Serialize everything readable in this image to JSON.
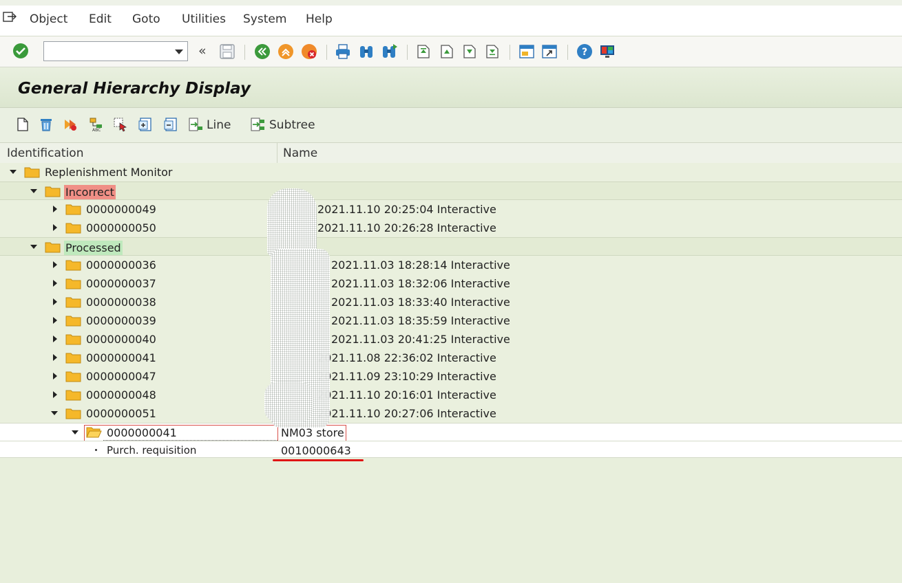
{
  "menu": {
    "items": [
      {
        "label": "Object"
      },
      {
        "label": "Edit"
      },
      {
        "label": "Goto"
      },
      {
        "label": "Utilities"
      },
      {
        "label": "System"
      },
      {
        "label": "Help"
      }
    ]
  },
  "toolbar": {
    "command_value": "",
    "back_glyph": "«"
  },
  "title": "General Hierarchy Display",
  "app_toolbar": {
    "line_label": "Line",
    "subtree_label": "Subtree"
  },
  "columns": {
    "identification": "Identification",
    "name": "Name"
  },
  "tree": {
    "root": "Replenishment Monitor",
    "incorrect": {
      "label": "Incorrect",
      "items": [
        {
          "id": "0000000049",
          "name": "2021.11.10 20:25:04 Interactive"
        },
        {
          "id": "0000000050",
          "name": "2021.11.10 20:26:28 Interactive"
        }
      ]
    },
    "processed": {
      "label": "Processed",
      "items": [
        {
          "id": "0000000036",
          "name": "2021.11.03 18:28:14 Interactive"
        },
        {
          "id": "0000000037",
          "name": "2021.11.03 18:32:06 Interactive"
        },
        {
          "id": "0000000038",
          "name": "2021.11.03 18:33:40 Interactive"
        },
        {
          "id": "0000000039",
          "name": "2021.11.03 18:35:59 Interactive"
        },
        {
          "id": "0000000040",
          "name": "2021.11.03 20:41:25 Interactive"
        },
        {
          "id": "0000000041",
          "name": "2021.11.08 22:36:02 Interactive"
        },
        {
          "id": "0000000047",
          "name": "2021.11.09 23:10:29 Interactive"
        },
        {
          "id": "0000000048",
          "name": "2021.11.10 20:16:01 Interactive"
        },
        {
          "id": "0000000051",
          "name": "2021.11.10 20:27:06 Interactive"
        }
      ]
    },
    "child": {
      "id": "0000000041",
      "name": "NM03 store"
    },
    "leaf": {
      "label": "Purch. requisition",
      "value": "0010000643"
    }
  },
  "icons": {
    "menu": "exit-menu-icon",
    "enter": "green-check-icon",
    "save": "save-icon",
    "back": "back-icon",
    "exit": "exit-icon",
    "cancel": "cancel-icon",
    "print": "print-icon",
    "find": "find-icon",
    "find_next": "find-next-icon",
    "first_page": "first-page-icon",
    "prev_page": "prev-page-icon",
    "next_page": "next-page-icon",
    "last_page": "last-page-icon",
    "new_session": "new-session-icon",
    "shortcut": "shortcut-icon",
    "help": "help-icon",
    "layout": "layout-icon"
  },
  "colors": {
    "incorrect_highlight": "#f08f86",
    "processed_highlight": "#bfe9bd",
    "annotation_red": "#e01515"
  }
}
